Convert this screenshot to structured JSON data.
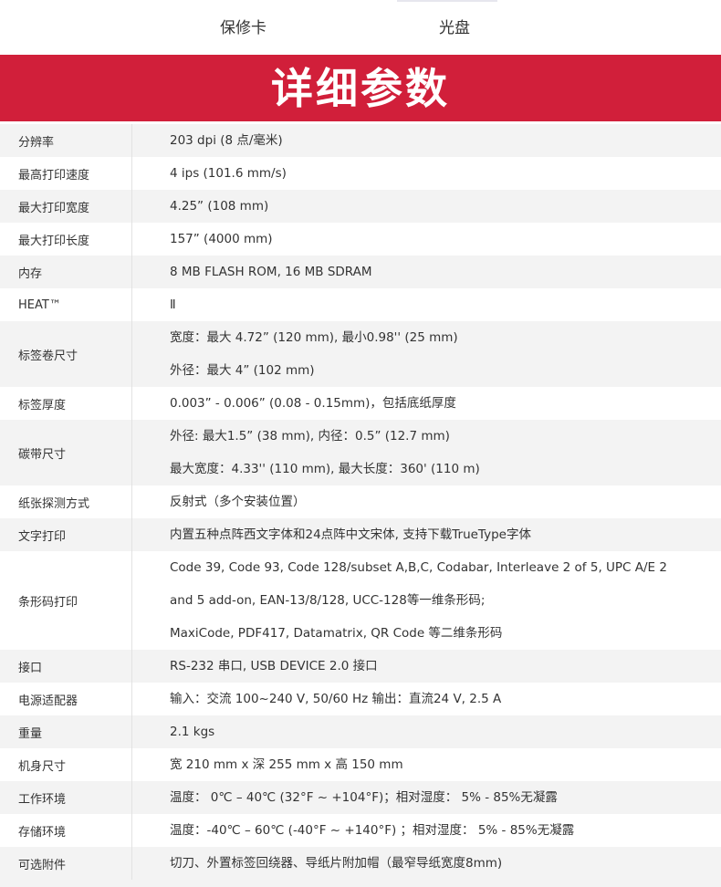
{
  "nav": {
    "warranty_label": "保修卡",
    "disc_label": "光盘"
  },
  "banner": {
    "title": "详细参数"
  },
  "specs": [
    {
      "label": "分辨率",
      "values": [
        "203 dpi (8 点/毫米)"
      ]
    },
    {
      "label": "最高打印速度",
      "values": [
        "4 ips (101.6 mm/s)"
      ]
    },
    {
      "label": "最大打印宽度",
      "values": [
        "4.25” (108 mm)"
      ]
    },
    {
      "label": "最大打印长度",
      "values": [
        "157” (4000 mm)"
      ]
    },
    {
      "label": "内存",
      "values": [
        "8 MB FLASH ROM, 16 MB SDRAM"
      ]
    },
    {
      "label": "HEAT™",
      "values": [
        "Ⅱ"
      ]
    },
    {
      "label": "标签卷尺寸",
      "values": [
        "宽度：最大 4.72” (120 mm), 最小0.98'' (25 mm)",
        "外径：最大 4” (102 mm)"
      ]
    },
    {
      "label": "标签厚度",
      "values": [
        "0.003” - 0.006” (0.08 - 0.15mm)，包括底纸厚度"
      ]
    },
    {
      "label": "碳带尺寸",
      "values": [
        "外径: 最大1.5” (38 mm), 内径：0.5” (12.7 mm)",
        "最大宽度：4.33'' (110 mm), 最大长度：360' (110 m)"
      ]
    },
    {
      "label": "纸张探测方式",
      "values": [
        "反射式（多个安装位置）"
      ]
    },
    {
      "label": "文字打印",
      "values": [
        "内置五种点阵西文字体和24点阵中文宋体, 支持下载TrueType字体"
      ]
    },
    {
      "label": "条形码打印",
      "values": [
        "Code 39, Code 93, Code 128/subset A,B,C, Codabar, Interleave 2 of 5, UPC A/E 2",
        "and 5 add-on, EAN-13/8/128, UCC-128等一维条形码;",
        "MaxiCode, PDF417, Datamatrix, QR Code 等二维条形码"
      ]
    },
    {
      "label": "接口",
      "values": [
        "RS-232 串口, USB DEVICE 2.0 接口"
      ]
    },
    {
      "label": "电源适配器",
      "values": [
        "输入：交流 100~240 V, 50/60 Hz 输出：直流24 V, 2.5 A"
      ]
    },
    {
      "label": "重量",
      "values": [
        "2.1 kgs"
      ]
    },
    {
      "label": "机身尺寸",
      "values": [
        "宽 210 mm x 深 255 mm x 高 150 mm"
      ]
    },
    {
      "label": "工作环境",
      "values": [
        "温度： 0℃ – 40℃ (32°F ~ +104°F)；相对湿度： 5% - 85%无凝露"
      ]
    },
    {
      "label": "存储环境",
      "values": [
        "温度：-40℃ – 60℃ (-40°F ~ +140°F) ；相对湿度： 5% - 85%无凝露"
      ]
    },
    {
      "label": "可选附件",
      "values": [
        "切刀、外置标签回绕器、导纸片附加帽（最窄导纸宽度8mm)"
      ]
    }
  ]
}
